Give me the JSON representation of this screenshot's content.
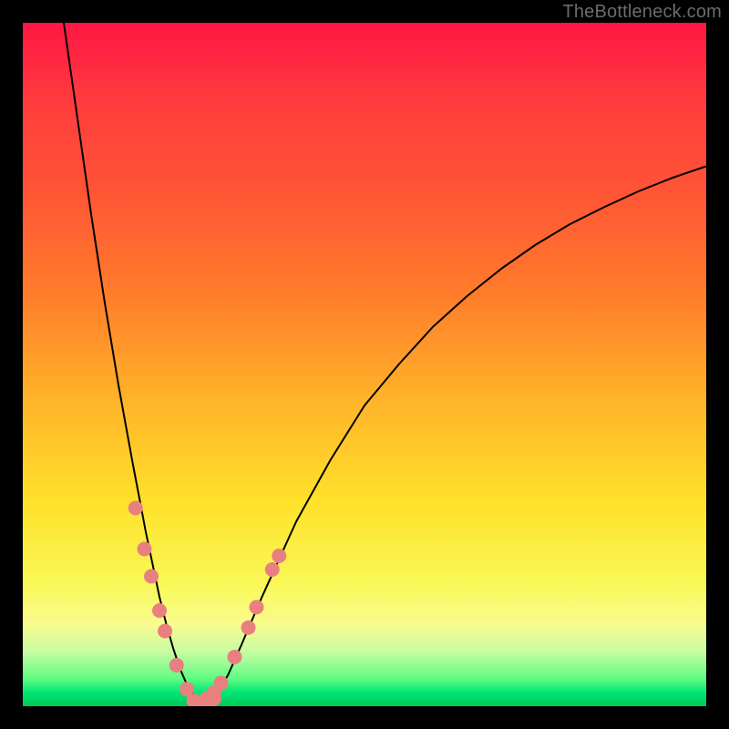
{
  "watermark": "TheBottleneck.com",
  "chart_data": {
    "type": "line",
    "title": "",
    "xlabel": "",
    "ylabel": "",
    "xlim": [
      0,
      100
    ],
    "ylim": [
      0,
      100
    ],
    "series": [
      {
        "name": "left-curve",
        "x": [
          6,
          8,
          10,
          12,
          14,
          16,
          18,
          20,
          21,
          22,
          23,
          24,
          25,
          26
        ],
        "values": [
          100,
          86,
          72,
          59,
          47,
          36,
          25.5,
          16,
          12,
          8.5,
          5.5,
          3.2,
          1.6,
          0.6
        ]
      },
      {
        "name": "right-curve",
        "x": [
          27,
          28,
          30,
          32,
          35,
          40,
          45,
          50,
          55,
          60,
          65,
          70,
          75,
          80,
          85,
          90,
          95,
          100
        ],
        "values": [
          0.6,
          1.4,
          4.5,
          9,
          16,
          27,
          36,
          44,
          50,
          55.5,
          60,
          64,
          67.5,
          70.5,
          73,
          75.3,
          77.3,
          79
        ]
      }
    ],
    "markers_left": [
      {
        "x": 16.5,
        "y": 29
      },
      {
        "x": 17.8,
        "y": 23
      },
      {
        "x": 18.8,
        "y": 19
      },
      {
        "x": 20.0,
        "y": 14
      },
      {
        "x": 20.8,
        "y": 11
      },
      {
        "x": 22.5,
        "y": 6
      },
      {
        "x": 24.0,
        "y": 2.5
      }
    ],
    "markers_right": [
      {
        "x": 27.0,
        "y": 1.2
      },
      {
        "x": 28.0,
        "y": 2.0
      },
      {
        "x": 29.0,
        "y": 3.4
      },
      {
        "x": 31.0,
        "y": 7.2
      },
      {
        "x": 33.0,
        "y": 11.5
      },
      {
        "x": 34.2,
        "y": 14.5
      },
      {
        "x": 36.5,
        "y": 20
      },
      {
        "x": 37.5,
        "y": 22
      }
    ],
    "markers_bottom": [
      {
        "x": 25.0,
        "y": 0.8
      },
      {
        "x": 26.0,
        "y": 0.6
      },
      {
        "x": 27.0,
        "y": 0.6
      },
      {
        "x": 28.0,
        "y": 1.1
      }
    ],
    "colors": {
      "curve": "#000000",
      "marker": "#e98080"
    }
  }
}
